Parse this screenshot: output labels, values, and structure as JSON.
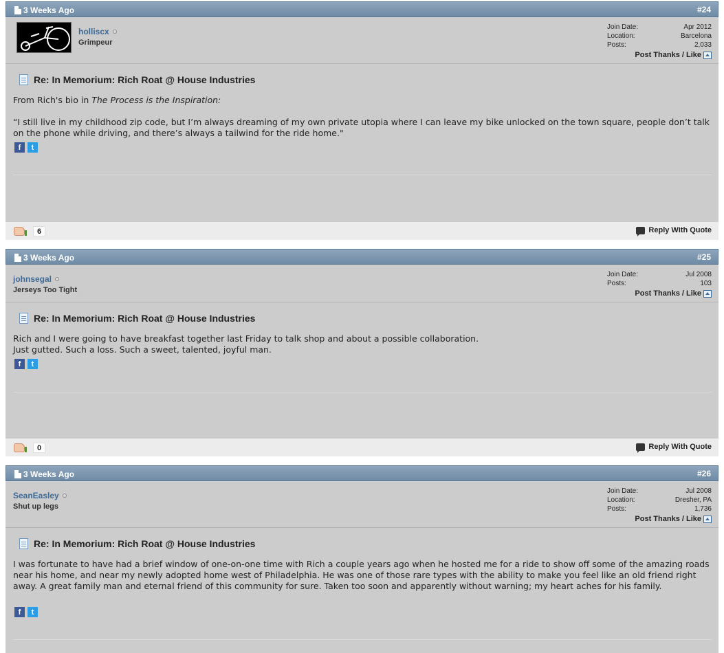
{
  "posts": [
    {
      "date": "3 Weeks Ago",
      "number": "#24",
      "username": "holliscx",
      "user_title": "Grimpeur",
      "info": [
        {
          "label": "Join Date:",
          "value": "Apr 2012"
        },
        {
          "label": "Location:",
          "value": "Barcelona"
        },
        {
          "label": "Posts:",
          "value": "2,033"
        }
      ],
      "thanks_label": "Post Thanks / Like",
      "title": "Re: In Memorium: Rich Roat @ House Industries",
      "body": {
        "intro_prefix": "From Rich's bio in ",
        "intro_italic": "The Process is the Inspiration:",
        "quote": "“I still live in my childhood zip code, but I’m always dreaming of my own private utopia where I can leave my bike unlocked on the town square, people don’t talk on the phone while driving, and there’s always a tailwind for the ride home.\""
      },
      "likes": "6",
      "reply_label": "Reply With Quote"
    },
    {
      "date": "3 Weeks Ago",
      "number": "#25",
      "username": "johnsegal",
      "user_title": "Jerseys Too Tight",
      "info": [
        {
          "label": "Join Date:",
          "value": "Jul 2008"
        },
        {
          "label": "Posts:",
          "value": "103"
        }
      ],
      "thanks_label": "Post Thanks / Like",
      "title": "Re: In Memorium: Rich Roat @ House Industries",
      "body": {
        "line1": "Rich and I were going to have breakfast together last Friday to talk shop and about a possible collaboration.",
        "line2": "Just gutted. Such a loss. Such a sweet, talented, joyful man."
      },
      "likes": "0",
      "reply_label": "Reply With Quote"
    },
    {
      "date": "3 Weeks Ago",
      "number": "#26",
      "username": "SeanEasley",
      "user_title": "Shut up legs",
      "info": [
        {
          "label": "Join Date:",
          "value": "Jul 2008"
        },
        {
          "label": "Location:",
          "value": "Dresher, PA"
        },
        {
          "label": "Posts:",
          "value": "1,736"
        }
      ],
      "thanks_label": "Post Thanks / Like",
      "title": "Re: In Memorium: Rich Roat @ House Industries",
      "body": {
        "text": "I was fortunate to have had a brief window of one-on-one time with Rich a couple years ago when he hosted me for a ride to show off some of the amazing roads near his home, and near my newly adopted home west of Philadelphia. He was one of those rare types with the ability to make you feel like an old friend right away. A great family man and eternal friend of this community for sure. Taken too soon and apparently without warning; my heart aches for his family."
      }
    }
  ],
  "share": {
    "facebook_glyph": "f",
    "twitter_glyph": "t"
  }
}
